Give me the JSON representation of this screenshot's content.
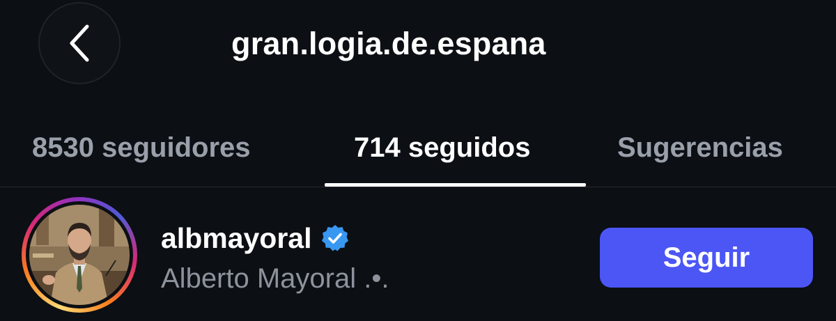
{
  "header": {
    "back_icon": "chevron-left-icon",
    "title": "gran.logia.de.espana"
  },
  "tabs": [
    {
      "label": "8530 seguidores",
      "active": false
    },
    {
      "label": "714 seguidos",
      "active": true
    },
    {
      "label": "Sugerencias",
      "active": false
    }
  ],
  "list": {
    "items": [
      {
        "avatar_icon": "profile-photo",
        "has_story_ring": true,
        "username": "albmayoral",
        "verified": true,
        "verified_icon": "verified-badge-icon",
        "full_name": "Alberto Mayoral .•.",
        "action_label": "Seguir"
      }
    ]
  },
  "colors": {
    "background": "#0c0f14",
    "accent_button": "#4b56f5",
    "verified_blue": "#3897f0",
    "secondary_text": "#8d939c",
    "inactive_tab": "#9aa0aa"
  }
}
